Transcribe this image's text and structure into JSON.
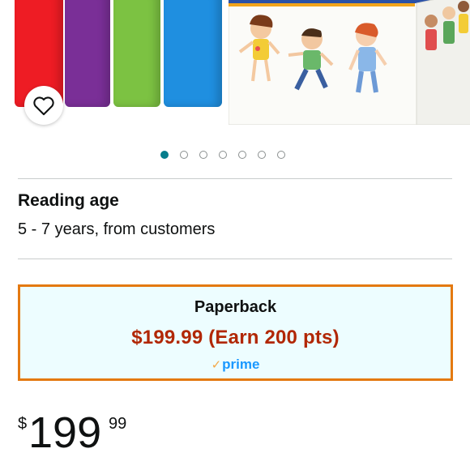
{
  "product_image": {
    "favorite_icon": "heart-outline-icon",
    "carousel_total": 7,
    "carousel_active_index": 0
  },
  "reading_age": {
    "label": "Reading age",
    "value": "5 - 7 years, from customers"
  },
  "format_option": {
    "name": "Paperback",
    "price_text": "$199.99 (Earn 200 pts)",
    "prime_label": "prime",
    "prime_check": "✓",
    "border_color": "#e47911",
    "price_color": "#b12704"
  },
  "price": {
    "symbol": "$",
    "whole": "199",
    "fraction": "99"
  }
}
